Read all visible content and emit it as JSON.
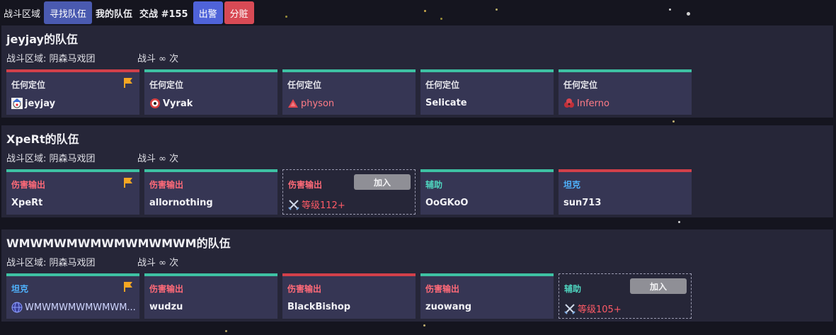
{
  "nav": {
    "zone": "战斗区域",
    "find_party": "寻找队伍",
    "my_party": "我的队伍",
    "battle": "交战 #155",
    "alert": "出警",
    "split": "分赃"
  },
  "teams": [
    {
      "title": "jeyjay的队伍",
      "zone": "战斗区域: 阴森马戏团",
      "battles": "战斗 ∞ 次",
      "slots": [
        {
          "role": "任何定位",
          "name": "jeyjay",
          "leader": true,
          "icon": "clown-icon"
        },
        {
          "role": "任何定位",
          "name": "Vyrak",
          "icon": "eye-icon"
        },
        {
          "role": "任何定位",
          "name": "physon",
          "icon": "triangle-icon"
        },
        {
          "role": "任何定位",
          "name": "Selicate"
        },
        {
          "role": "任何定位",
          "name": "Inferno",
          "icon": "claw-icon"
        }
      ]
    },
    {
      "title": "XpeRt的队伍",
      "zone": "战斗区域: 阴森马戏团",
      "battles": "战斗 ∞ 次",
      "slots": [
        {
          "role": "伤害输出",
          "name": "XpeRt",
          "leader": true
        },
        {
          "role": "伤害输出",
          "name": "allornothing"
        },
        {
          "role": "伤害输出",
          "join": "加入",
          "level": "等级112+"
        },
        {
          "role": "辅助",
          "name": "OoGKoO"
        },
        {
          "role": "坦克",
          "name": "sun713"
        }
      ]
    },
    {
      "title": "WMWMWMWMWMWMWMWM的队伍",
      "zone": "战斗区域: 阴森马戏团",
      "battles": "战斗 ∞ 次",
      "slots": [
        {
          "role": "坦克",
          "name": "WMWMWMWMWMWM...",
          "leader": true,
          "icon": "globe-icon"
        },
        {
          "role": "伤害输出",
          "name": "wudzu"
        },
        {
          "role": "伤害输出",
          "name": "BlackBishop"
        },
        {
          "role": "伤害输出",
          "name": "zuowang"
        },
        {
          "role": "辅助",
          "join": "加入",
          "level": "等级105+"
        }
      ]
    }
  ],
  "colors": {
    "tank_green_bar": "#3ec1a3",
    "dps_red_bar": "#d2404a",
    "flag": "#f5a623",
    "tank_text": "#4fb3ff",
    "dps_text": "#ff6a78",
    "support_text": "#4fd6c0"
  }
}
